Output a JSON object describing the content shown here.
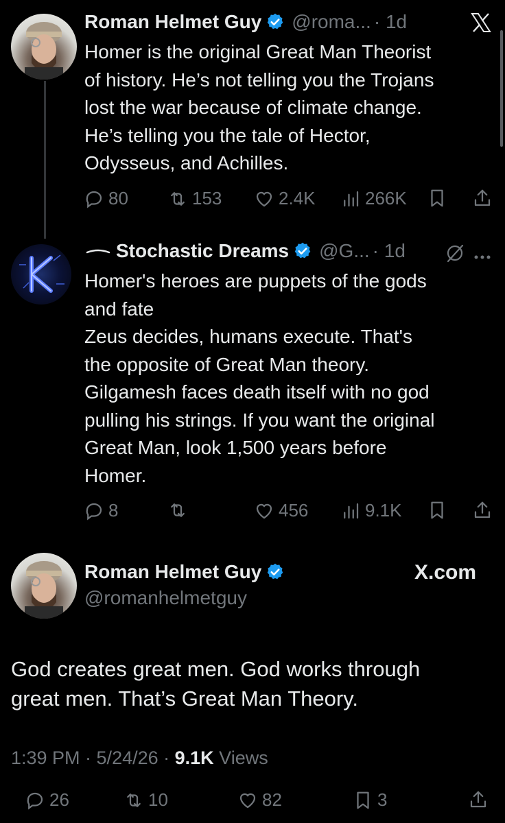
{
  "post1": {
    "display_name": "Roman Helmet Guy",
    "handle": "@roma...",
    "time": "· 1d",
    "brand_icon": "x-logo-icon",
    "text": "Homer is the original Great Man Theorist\nof history. He’s not telling you the Trojans\nlost the war because of climate change.\nHe’s telling you the tale of Hector,\nOdysseus, and Achilles.",
    "stats": {
      "replies": "80",
      "reposts": "153",
      "likes": "2.4K",
      "views": "266K"
    }
  },
  "post2": {
    "display_name": "Stochastic Dreams",
    "handle": "@G...",
    "time": "· 1d",
    "grok_icon": "grok-icon",
    "more_icon": "more-icon",
    "text": "Homer's heroes are puppets of the gods\nand fate\n Zeus decides, humans execute. That's\nthe opposite of Great Man theory.\n Gilgamesh faces death itself with no god\npulling his strings. If you want the original\nGreat Man, look 1,500 years before\nHomer.",
    "stats": {
      "replies": "8",
      "reposts": "",
      "likes": "456",
      "views": "9.1K"
    }
  },
  "post3": {
    "display_name": "Roman Helmet Guy",
    "handle": "@romanhelmetguy",
    "brand": "X.com",
    "text": "God creates great men. God works through\ngreat men. That’s Great Man Theory.",
    "timestamp": "1:39 PM · 5/24/26 · ",
    "views_count": "9.1K",
    "views_label": " Views",
    "stats": {
      "replies": "26",
      "reposts": "10",
      "likes": "82",
      "bookmarks": "3"
    }
  },
  "colors": {
    "background": "#000000",
    "text": "#e7e9ea",
    "muted": "#71767b",
    "verified": "#1d9bf0",
    "thread_line": "#333639"
  }
}
